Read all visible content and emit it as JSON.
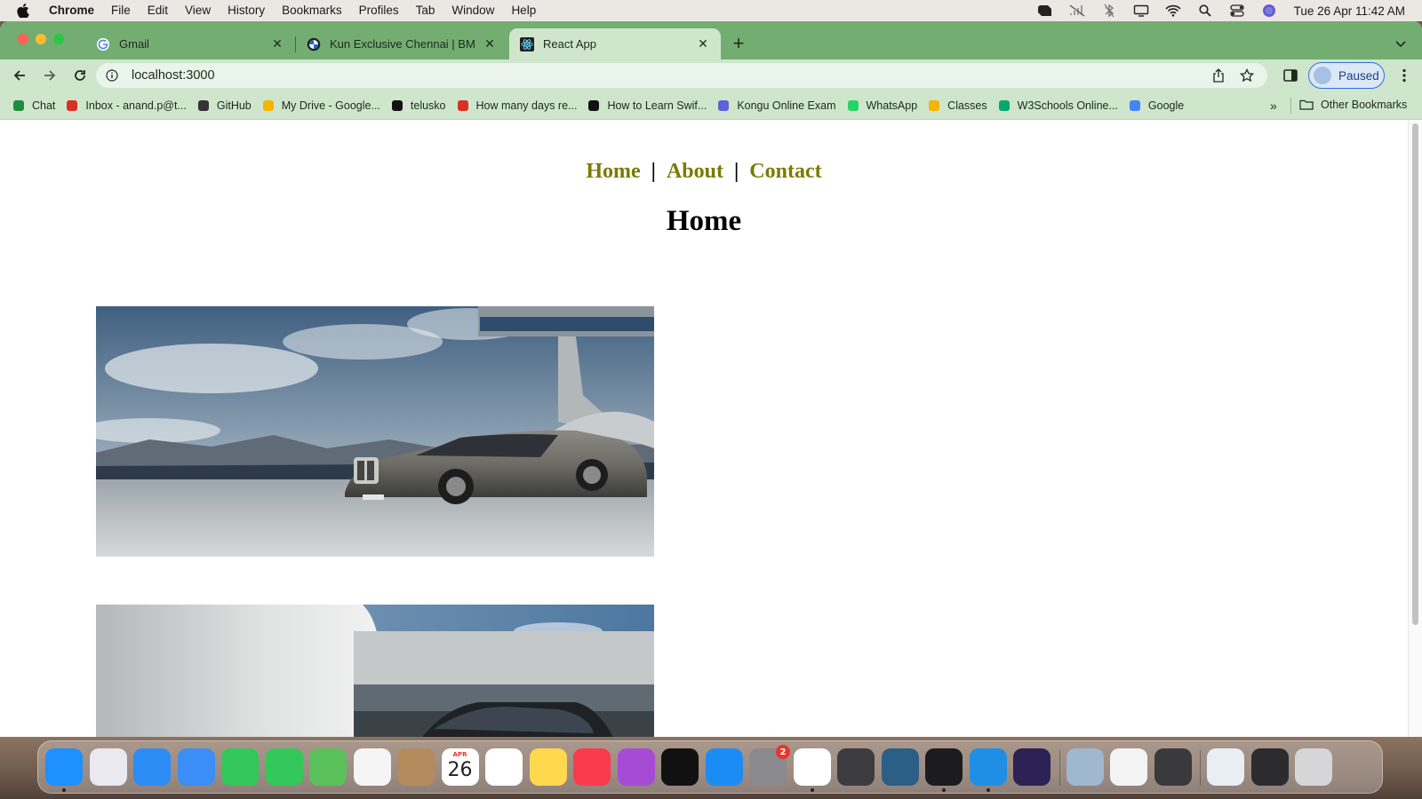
{
  "menubar": {
    "app_name": "Chrome",
    "items": [
      "File",
      "Edit",
      "View",
      "History",
      "Bookmarks",
      "Profiles",
      "Tab",
      "Window",
      "Help"
    ],
    "clock": "Tue 26 Apr  11:42 AM"
  },
  "tabs": [
    {
      "title": "Gmail",
      "icon": "google-icon"
    },
    {
      "title": "Kun Exclusive Chennai | BMW I",
      "icon": "bmw-icon"
    },
    {
      "title": "React App",
      "icon": "react-icon",
      "active": true
    }
  ],
  "toolbar": {
    "url": "localhost:3000",
    "profile_label": "Paused"
  },
  "bookmarks": {
    "items": [
      {
        "label": "Chat",
        "icon": "chat-icon",
        "color": "#1e8e3e"
      },
      {
        "label": "Inbox - anand.p@t...",
        "icon": "gmail-icon",
        "color": "#d93025"
      },
      {
        "label": "GitHub",
        "icon": "github-icon",
        "color": "#333333"
      },
      {
        "label": "My Drive - Google...",
        "icon": "drive-icon",
        "color": "#f4b400"
      },
      {
        "label": "telusko",
        "icon": "telusko-icon",
        "color": "#111111"
      },
      {
        "label": "How many days re...",
        "icon": "y-icon",
        "color": "#d93025"
      },
      {
        "label": "How to Learn Swif...",
        "icon": "swift-icon",
        "color": "#111111"
      },
      {
        "label": "Kongu Online Exam",
        "icon": "kongu-icon",
        "color": "#5b63d6"
      },
      {
        "label": "WhatsApp",
        "icon": "whatsapp-icon",
        "color": "#25d366"
      },
      {
        "label": "Classes",
        "icon": "classroom-icon",
        "color": "#f4b400"
      },
      {
        "label": "W3Schools Online...",
        "icon": "w3schools-icon",
        "color": "#04aa6d"
      },
      {
        "label": "Google",
        "icon": "google-icon",
        "color": "#4285f4"
      }
    ],
    "more": "»",
    "other": "Other Bookmarks"
  },
  "page": {
    "nav": {
      "home": "Home",
      "sep1": "|",
      "about": "About",
      "sep2": "|",
      "contact": "Contact"
    },
    "title": "Home"
  },
  "dock": {
    "calendar_month": "APR",
    "calendar_day": "26",
    "settings_badge": "2",
    "apps": [
      {
        "name": "finder",
        "color": "#1e90ff"
      },
      {
        "name": "launchpad",
        "color": "#e9e9ef"
      },
      {
        "name": "safari",
        "color": "#2b8cf5"
      },
      {
        "name": "mail",
        "color": "#3a8ef6"
      },
      {
        "name": "facetime",
        "color": "#34c759"
      },
      {
        "name": "messages",
        "color": "#34c759"
      },
      {
        "name": "maps",
        "color": "#5ac05a"
      },
      {
        "name": "photos",
        "color": "#f5f5f5"
      },
      {
        "name": "contacts",
        "color": "#b58a5c"
      },
      {
        "name": "calendar",
        "color": "#ffffff"
      },
      {
        "name": "reminders",
        "color": "#ffffff"
      },
      {
        "name": "notes",
        "color": "#ffd84d"
      },
      {
        "name": "music",
        "color": "#fa3a4d"
      },
      {
        "name": "podcasts",
        "color": "#a64bd6"
      },
      {
        "name": "tv",
        "color": "#111111"
      },
      {
        "name": "app-store",
        "color": "#1c8cf5"
      },
      {
        "name": "system-settings",
        "color": "#8a8a8e"
      },
      {
        "name": "chrome",
        "color": "#ffffff"
      },
      {
        "name": "keychain",
        "color": "#3c3c40"
      },
      {
        "name": "mysql-workbench",
        "color": "#2b5f86"
      },
      {
        "name": "terminal",
        "color": "#1c1c1e"
      },
      {
        "name": "vscode",
        "color": "#1f8fe5"
      },
      {
        "name": "eclipse",
        "color": "#2c2255"
      },
      {
        "name": "preview",
        "color": "#9fb7cf"
      },
      {
        "name": "textedit",
        "color": "#f3f3f3"
      },
      {
        "name": "calculator",
        "color": "#3a3a3c"
      },
      {
        "name": "document",
        "color": "#e9eef5"
      },
      {
        "name": "screen-window",
        "color": "#2c2c2e"
      },
      {
        "name": "trash",
        "color": "#d6d6d8"
      }
    ]
  }
}
